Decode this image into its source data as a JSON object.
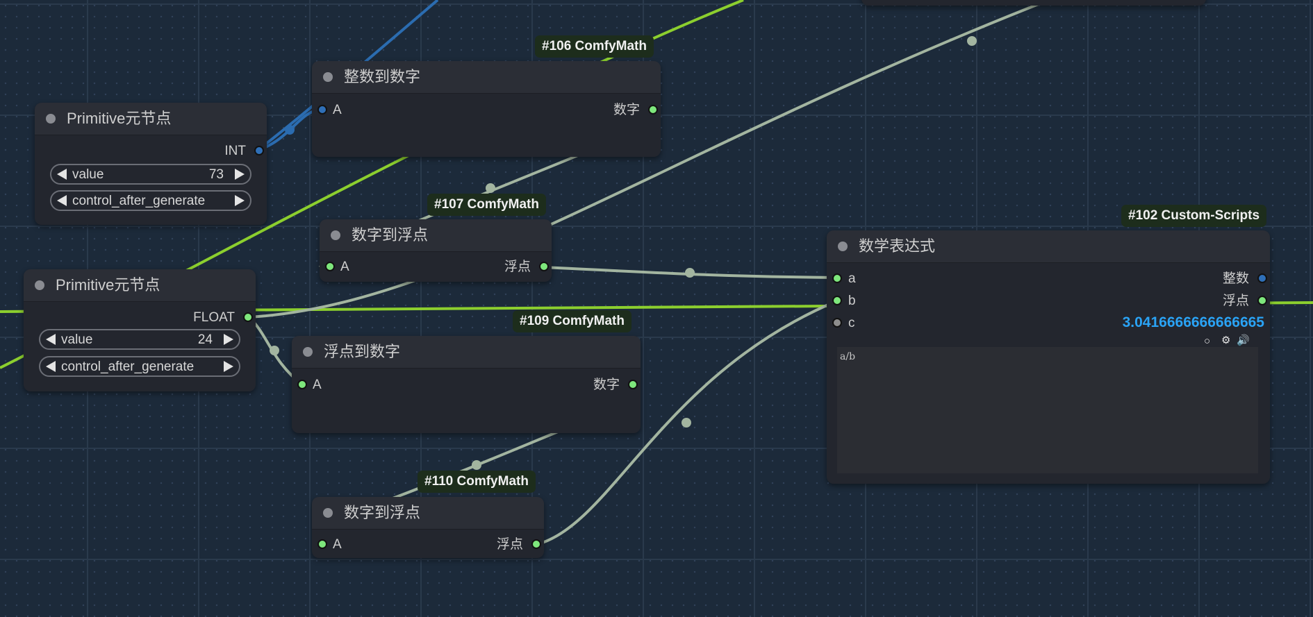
{
  "nodes": {
    "primitive_int": {
      "title": "Primitive元节点",
      "output": "INT",
      "widget_value": {
        "name": "value",
        "value": "73"
      },
      "widget_control": {
        "name": "control_after_generate"
      }
    },
    "primitive_float": {
      "title": "Primitive元节点",
      "output": "FLOAT",
      "widget_value": {
        "name": "value",
        "value": "24"
      },
      "widget_control": {
        "name": "control_after_generate"
      }
    },
    "n106": {
      "badge": "#106 ComfyMath",
      "title": "整数到数字",
      "input": "A",
      "output": "数字"
    },
    "n107": {
      "badge": "#107 ComfyMath",
      "title": "数字到浮点",
      "input": "A",
      "output": "浮点"
    },
    "n109": {
      "badge": "#109 ComfyMath",
      "title": "浮点到数字",
      "input": "A",
      "output": "数字"
    },
    "n110": {
      "badge": "#110 ComfyMath",
      "title": "数字到浮点",
      "input": "A",
      "output": "浮点"
    },
    "n102": {
      "badge": "#102 Custom-Scripts",
      "title": "数学表达式",
      "inputs": [
        "a",
        "b",
        "c"
      ],
      "outputs": [
        "整数",
        "浮点"
      ],
      "result": "3.0416666666666665",
      "expression": "a/b",
      "icons": [
        "circle-icon",
        "gear-icon",
        "speaker-icon"
      ]
    }
  },
  "colors": {
    "canvas_bg": "#1c2a3a",
    "node_bg": "#23262e",
    "node_header": "#2b2e36",
    "wire_green": "#8ccf2e",
    "wire_blue": "#2b6cb0",
    "wire_grey": "#a3b5a0",
    "socket_green": "#7ee77c",
    "socket_blue": "#2f6fb7",
    "result_blue": "#2aa3f5",
    "badge_bg": "#1d2d1c"
  }
}
